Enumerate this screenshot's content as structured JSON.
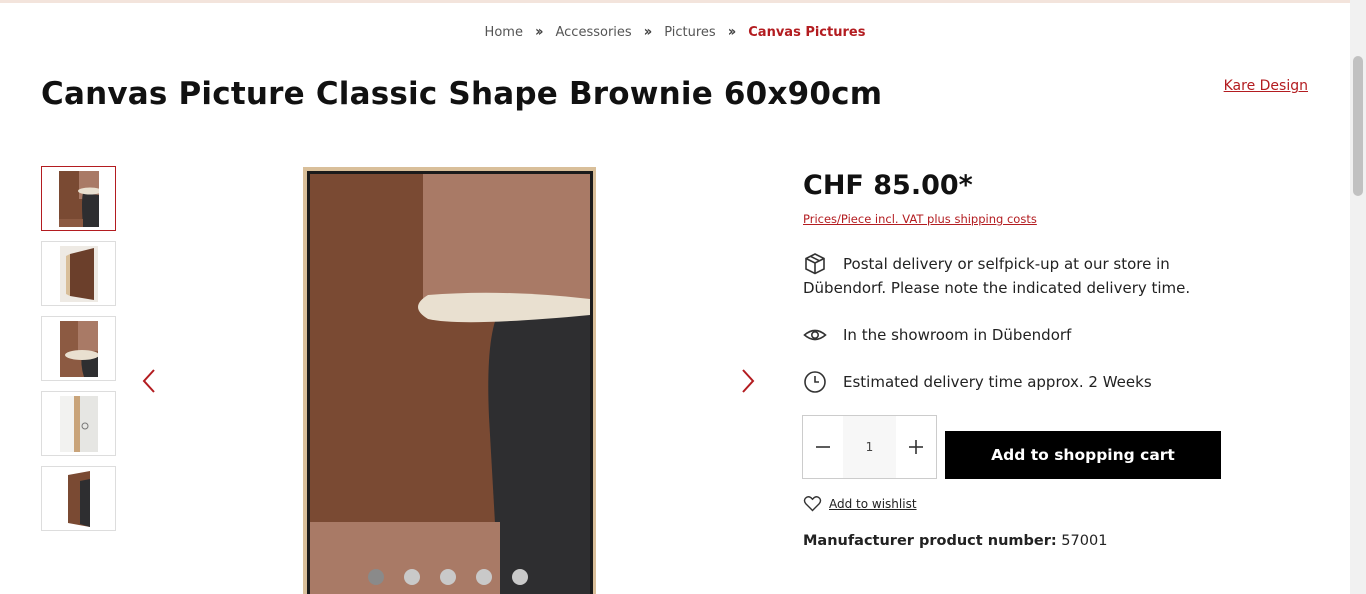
{
  "breadcrumb": {
    "items": [
      "Home",
      "Accessories",
      "Pictures"
    ],
    "current": "Canvas Pictures"
  },
  "product": {
    "title": "Canvas Picture Classic Shape Brownie 60x90cm",
    "brand": "Kare Design",
    "price": "CHF 85.00*",
    "price_note": "Prices/Piece incl. VAT plus shipping costs",
    "postal_info": "Postal delivery or selfpick-up at our store in Dübendorf. Please note the indicated delivery time.",
    "showroom_info": "In the showroom in Dübendorf",
    "delivery_info": "Estimated delivery time approx. 2 Weeks",
    "quantity": "1",
    "add_to_cart_label": "Add to shopping cart",
    "wishlist_label": "Add to wishlist",
    "mpn_label": "Manufacturer product number:",
    "mpn_value": "57001"
  },
  "gallery": {
    "thumbnail_count": 5,
    "active_index": 0,
    "dot_count": 5
  },
  "colors": {
    "accent": "#b31c20",
    "button_bg": "#000000",
    "canvas_brown": "#7a4a33",
    "canvas_rose": "#a97a66",
    "canvas_dark": "#2e2e30",
    "canvas_cream": "#e9e0d0",
    "frame": "#d9bf9a"
  },
  "icons": [
    "chevron-double-right-icon",
    "box-icon",
    "eye-icon",
    "clock-icon",
    "minus-icon",
    "plus-icon",
    "heart-icon",
    "chevron-left-icon",
    "chevron-right-icon"
  ]
}
